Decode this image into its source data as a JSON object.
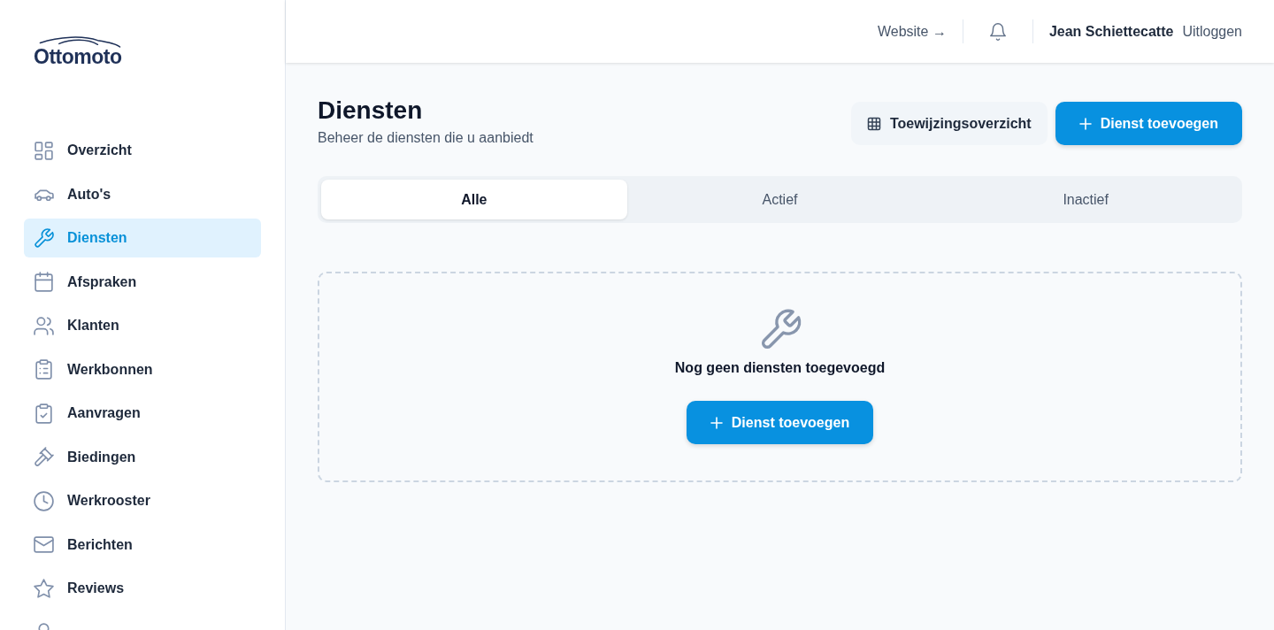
{
  "logo": {
    "text": "Ottomoto"
  },
  "sidebar": {
    "items": [
      {
        "label": "Overzicht",
        "selected": false
      },
      {
        "label": "Auto's",
        "selected": false
      },
      {
        "label": "Diensten",
        "selected": true
      },
      {
        "label": "Afspraken",
        "selected": false
      },
      {
        "label": "Klanten",
        "selected": false
      },
      {
        "label": "Werkbonnen",
        "selected": false
      },
      {
        "label": "Aanvragen",
        "selected": false
      },
      {
        "label": "Biedingen",
        "selected": false
      },
      {
        "label": "Werkrooster",
        "selected": false
      },
      {
        "label": "Berichten",
        "selected": false
      },
      {
        "label": "Reviews",
        "selected": false
      },
      {
        "selected": false
      }
    ]
  },
  "header": {
    "website_link": "Website →",
    "user_name": "Jean Schiettecatte",
    "logout": "Uitloggen"
  },
  "page": {
    "title": "Diensten",
    "subtitle": "Beheer de diensten die u aanbiedt",
    "buttons": [
      {
        "label": "Toewijzingsoverzicht",
        "kind": "secondary"
      },
      {
        "label": "Dienst toevoegen",
        "kind": "primary"
      }
    ]
  },
  "tabs": [
    {
      "label": "Alle",
      "selected": true
    },
    {
      "label": "Actief",
      "selected": false
    },
    {
      "label": "Inactief",
      "selected": false
    }
  ],
  "empty_state": {
    "message": "Nog geen diensten toegevoegd",
    "button": "Dienst toevoegen"
  }
}
